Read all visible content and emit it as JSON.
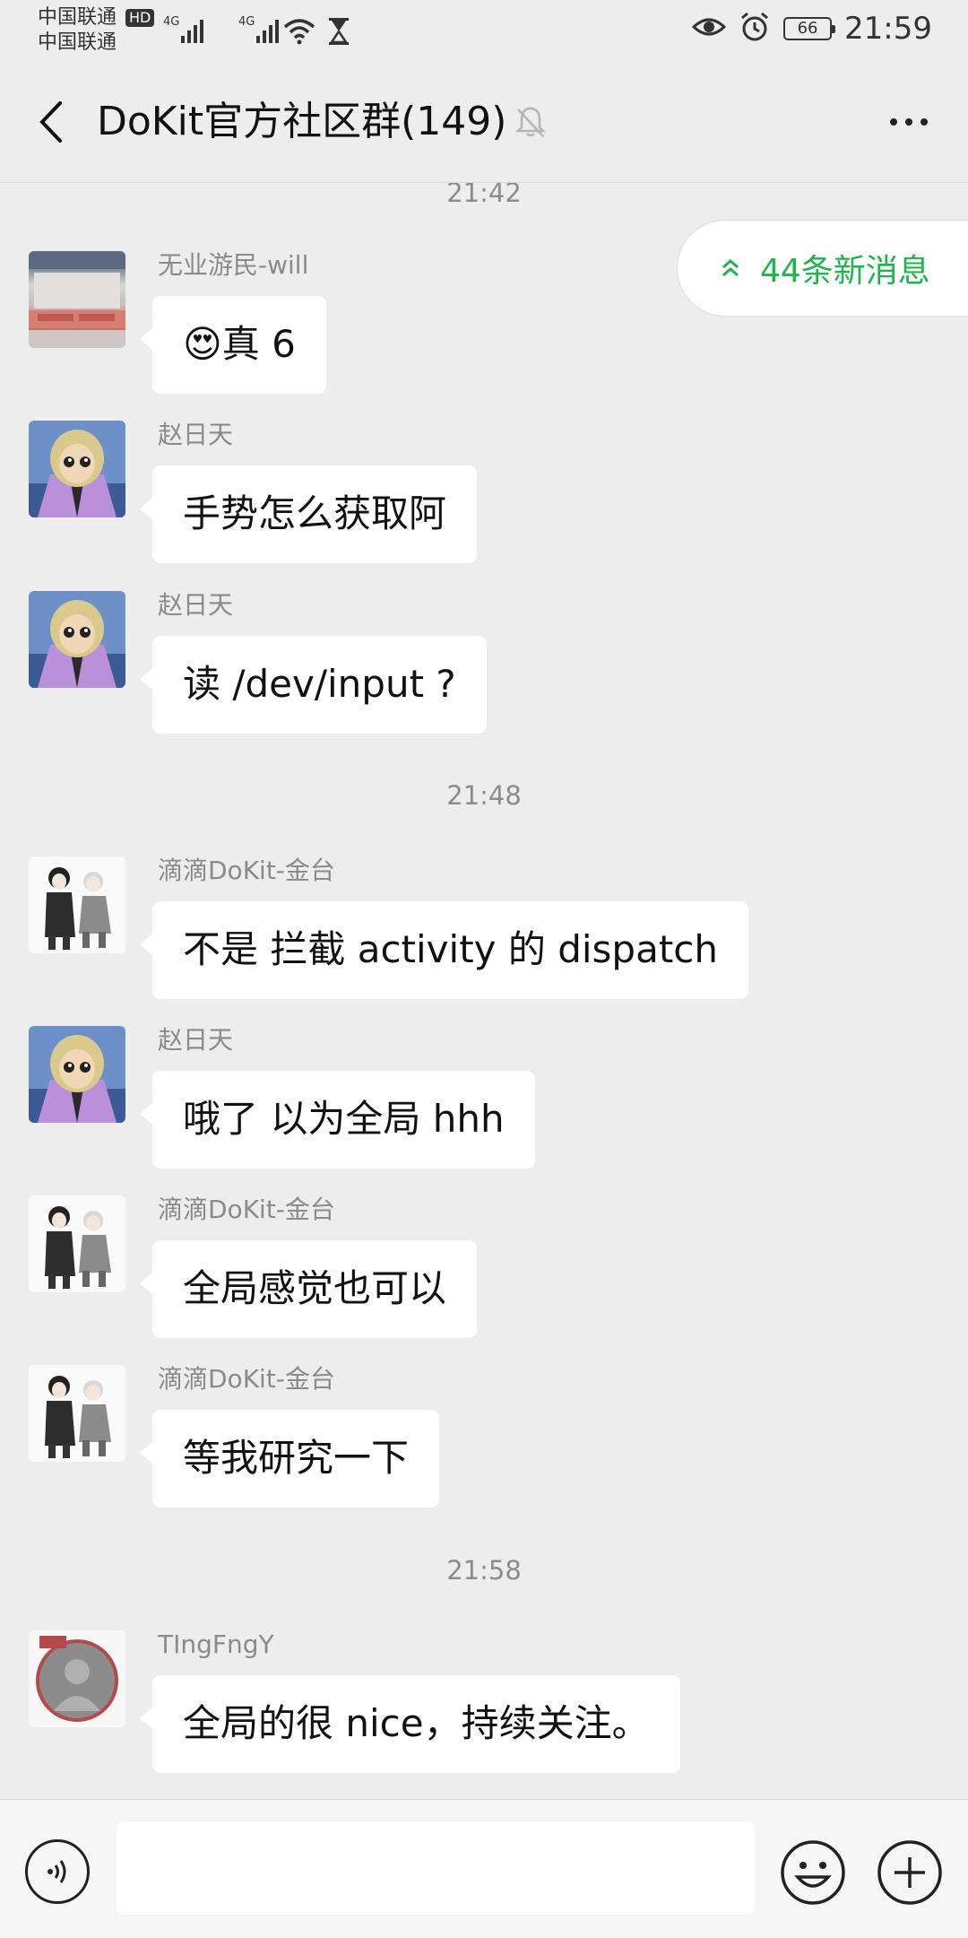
{
  "status_bar": {
    "carrier_1": "中国联通",
    "hd": "HD",
    "carrier_2": "中国联通",
    "network_1": "4G",
    "network_2": "4G",
    "battery": "66",
    "time": "21:59"
  },
  "header": {
    "title": "DoKit官方社区群(149)"
  },
  "new_messages": {
    "label": "44条新消息"
  },
  "timestamps": [
    "21:42",
    "21:48",
    "21:58"
  ],
  "messages": [
    {
      "sender": "无业游民-will",
      "text": "真 6",
      "emoji": "😍"
    },
    {
      "sender": "赵日天",
      "text": "手势怎么获取阿"
    },
    {
      "sender": "赵日天",
      "text": "读 /dev/input ?"
    },
    {
      "sender": "滴滴DoKit-金台",
      "text": "不是 拦截 activity 的 dispatch"
    },
    {
      "sender": "赵日天",
      "text": "哦了 以为全局 hhh"
    },
    {
      "sender": "滴滴DoKit-金台",
      "text": "全局感觉也可以"
    },
    {
      "sender": "滴滴DoKit-金台",
      "text": "等我研究一下"
    },
    {
      "sender": "TIngFngY",
      "text": "全局的很 nice，持续关注。"
    }
  ],
  "input": {
    "value": "",
    "placeholder": ""
  },
  "colors": {
    "background": "#ededed",
    "bubble": "#ffffff",
    "accent_green": "#20b44c",
    "meta_text": "#8a8a8a"
  },
  "icons": [
    "back-arrow-icon",
    "mute-bell-icon",
    "more-icon",
    "voice-icon",
    "emoji-icon",
    "plus-icon",
    "eye-icon",
    "alarm-icon",
    "wifi-icon",
    "hourglass-icon",
    "double-chevron-up-icon"
  ]
}
